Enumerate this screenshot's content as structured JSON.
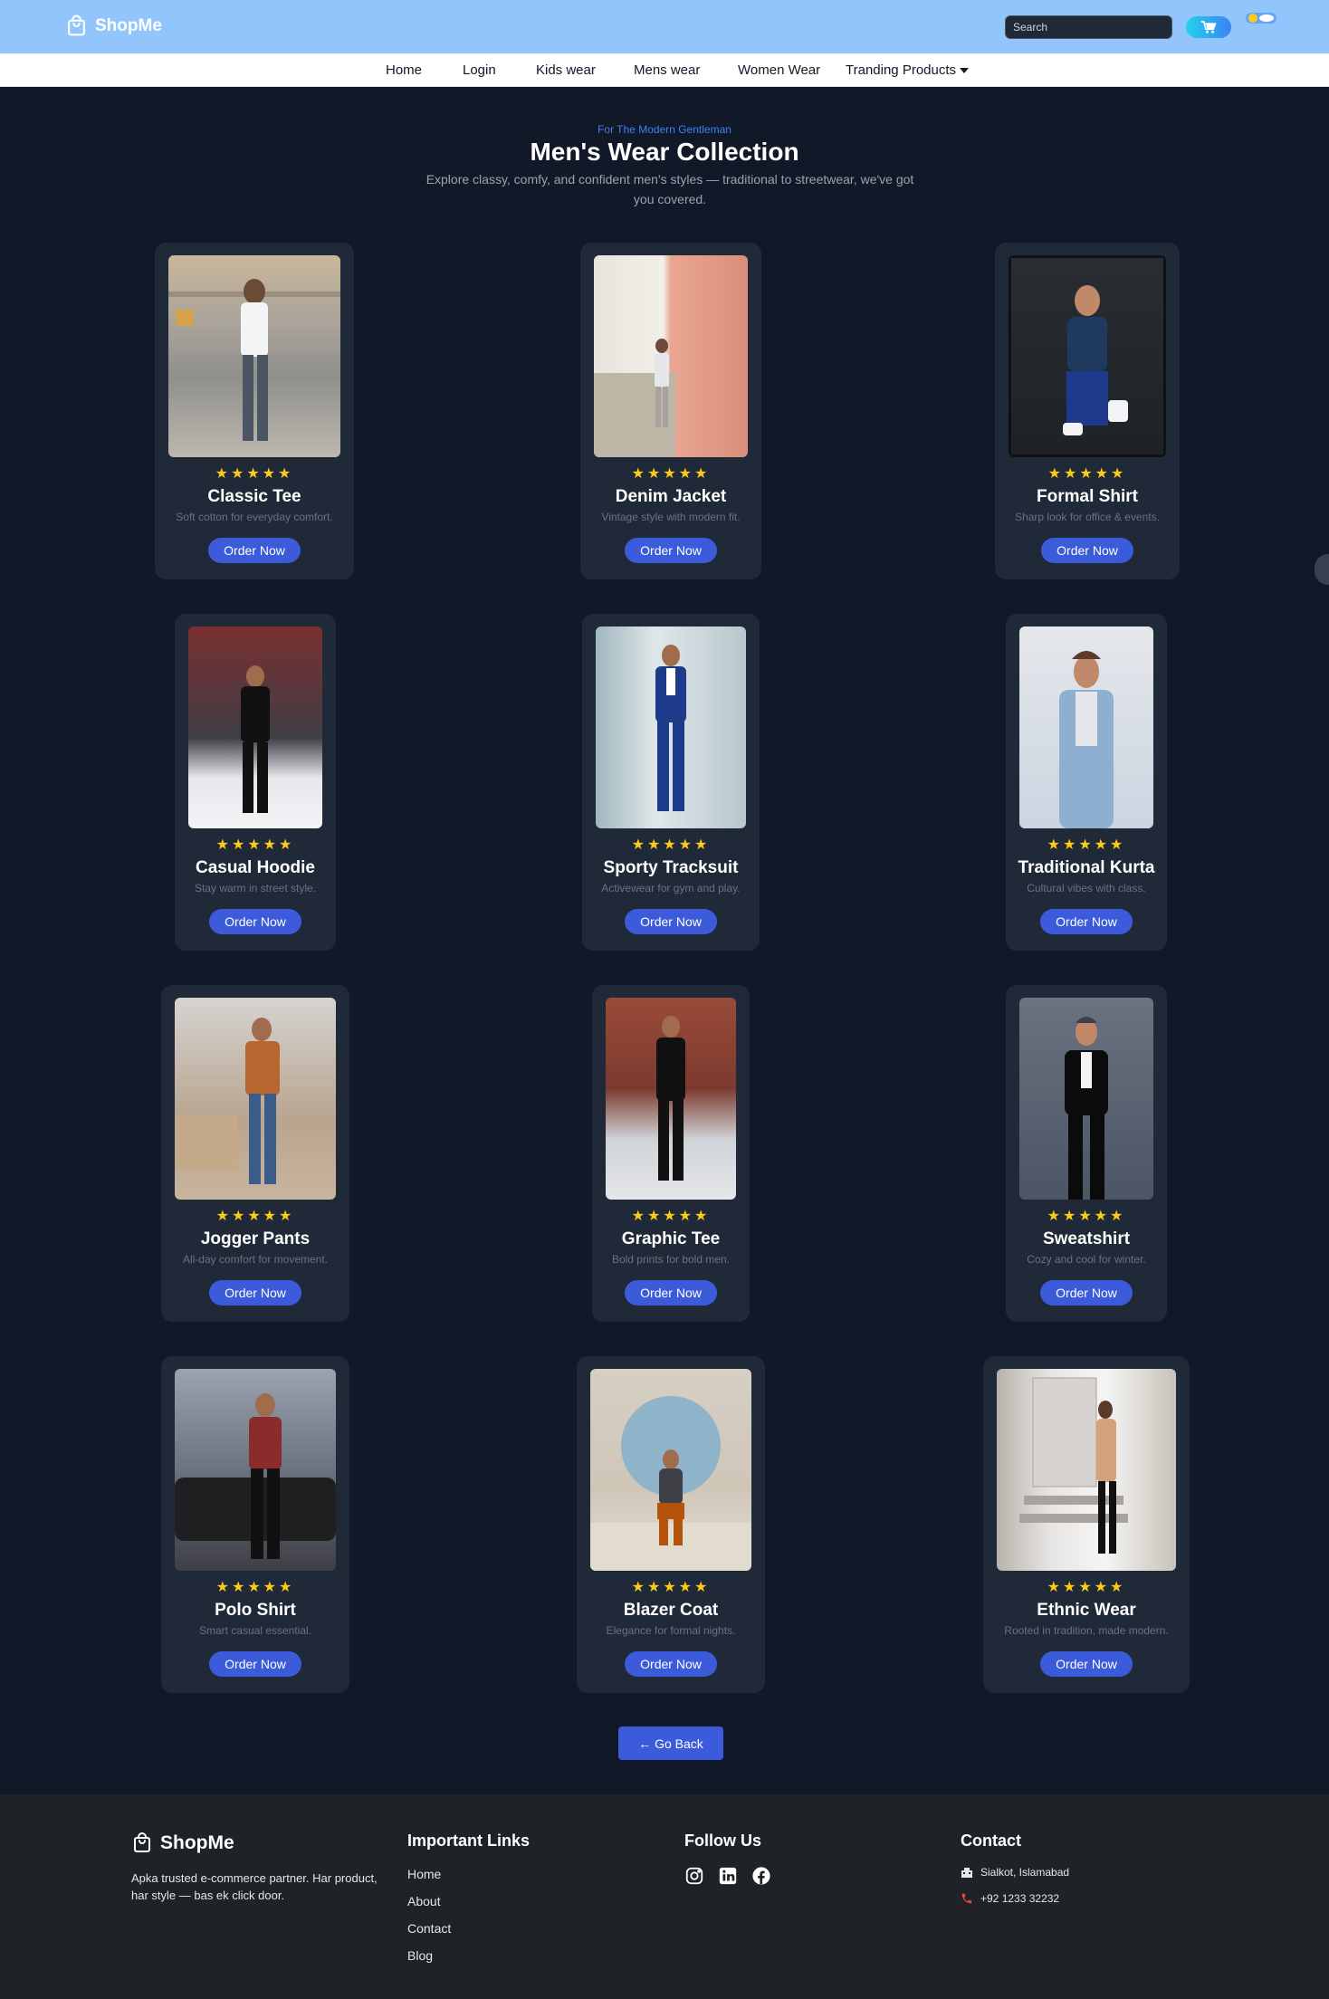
{
  "header": {
    "brand": "ShopMe",
    "search_placeholder": "Search"
  },
  "nav": {
    "items": [
      "Home",
      "Login",
      "Kids wear",
      "Mens wear",
      "Women Wear",
      "Tranding Products"
    ]
  },
  "hero": {
    "eyebrow": "For The Modern Gentleman",
    "title": "Men's Wear Collection",
    "subtitle": "Explore classy, comfy, and confident men's styles — traditional to streetwear, we've got you covered."
  },
  "products": [
    {
      "title": "Classic Tee",
      "desc": "Soft cotton for everyday comfort.",
      "stars": "★★★★★",
      "cta": "Order Now"
    },
    {
      "title": "Denim Jacket",
      "desc": "Vintage style with modern fit.",
      "stars": "★★★★★",
      "cta": "Order Now"
    },
    {
      "title": "Formal Shirt",
      "desc": "Sharp look for office & events.",
      "stars": "★★★★★",
      "cta": "Order Now"
    },
    {
      "title": "Casual Hoodie",
      "desc": "Stay warm in street style.",
      "stars": "★★★★★",
      "cta": "Order Now"
    },
    {
      "title": "Sporty Tracksuit",
      "desc": "Activewear for gym and play.",
      "stars": "★★★★★",
      "cta": "Order Now"
    },
    {
      "title": "Traditional Kurta",
      "desc": "Cultural vibes with class.",
      "stars": "★★★★★",
      "cta": "Order Now"
    },
    {
      "title": "Jogger Pants",
      "desc": "All-day comfort for movement.",
      "stars": "★★★★★",
      "cta": "Order Now"
    },
    {
      "title": "Graphic Tee",
      "desc": "Bold prints for bold men.",
      "stars": "★★★★★",
      "cta": "Order Now"
    },
    {
      "title": "Sweatshirt",
      "desc": "Cozy and cool for winter.",
      "stars": "★★★★★",
      "cta": "Order Now"
    },
    {
      "title": "Polo Shirt",
      "desc": "Smart casual essential.",
      "stars": "★★★★★",
      "cta": "Order Now"
    },
    {
      "title": "Blazer Coat",
      "desc": "Elegance for formal nights.",
      "stars": "★★★★★",
      "cta": "Order Now"
    },
    {
      "title": "Ethnic Wear",
      "desc": "Rooted in tradition, made modern.",
      "stars": "★★★★★",
      "cta": "Order Now"
    }
  ],
  "go_back": "← Go Back",
  "footer": {
    "brand": "ShopMe",
    "tagline": "Apka trusted e-commerce partner. Har product, har style — bas ek click door.",
    "links_heading": "Important Links",
    "links": [
      "Home",
      "About",
      "Contact",
      "Blog"
    ],
    "follow_heading": "Follow Us",
    "social": [
      "instagram-icon",
      "linkedin-icon",
      "facebook-icon"
    ],
    "contact_heading": "Contact",
    "address": "Sialkot, Islamabad",
    "phone": "+92 1233 32232"
  },
  "colors": {
    "header_bg": "#93c5fd",
    "page_bg": "#111827",
    "card_bg": "#1f2937",
    "accent": "#3b5bdb",
    "star": "#facc15",
    "footer_bg": "#1f2227"
  }
}
